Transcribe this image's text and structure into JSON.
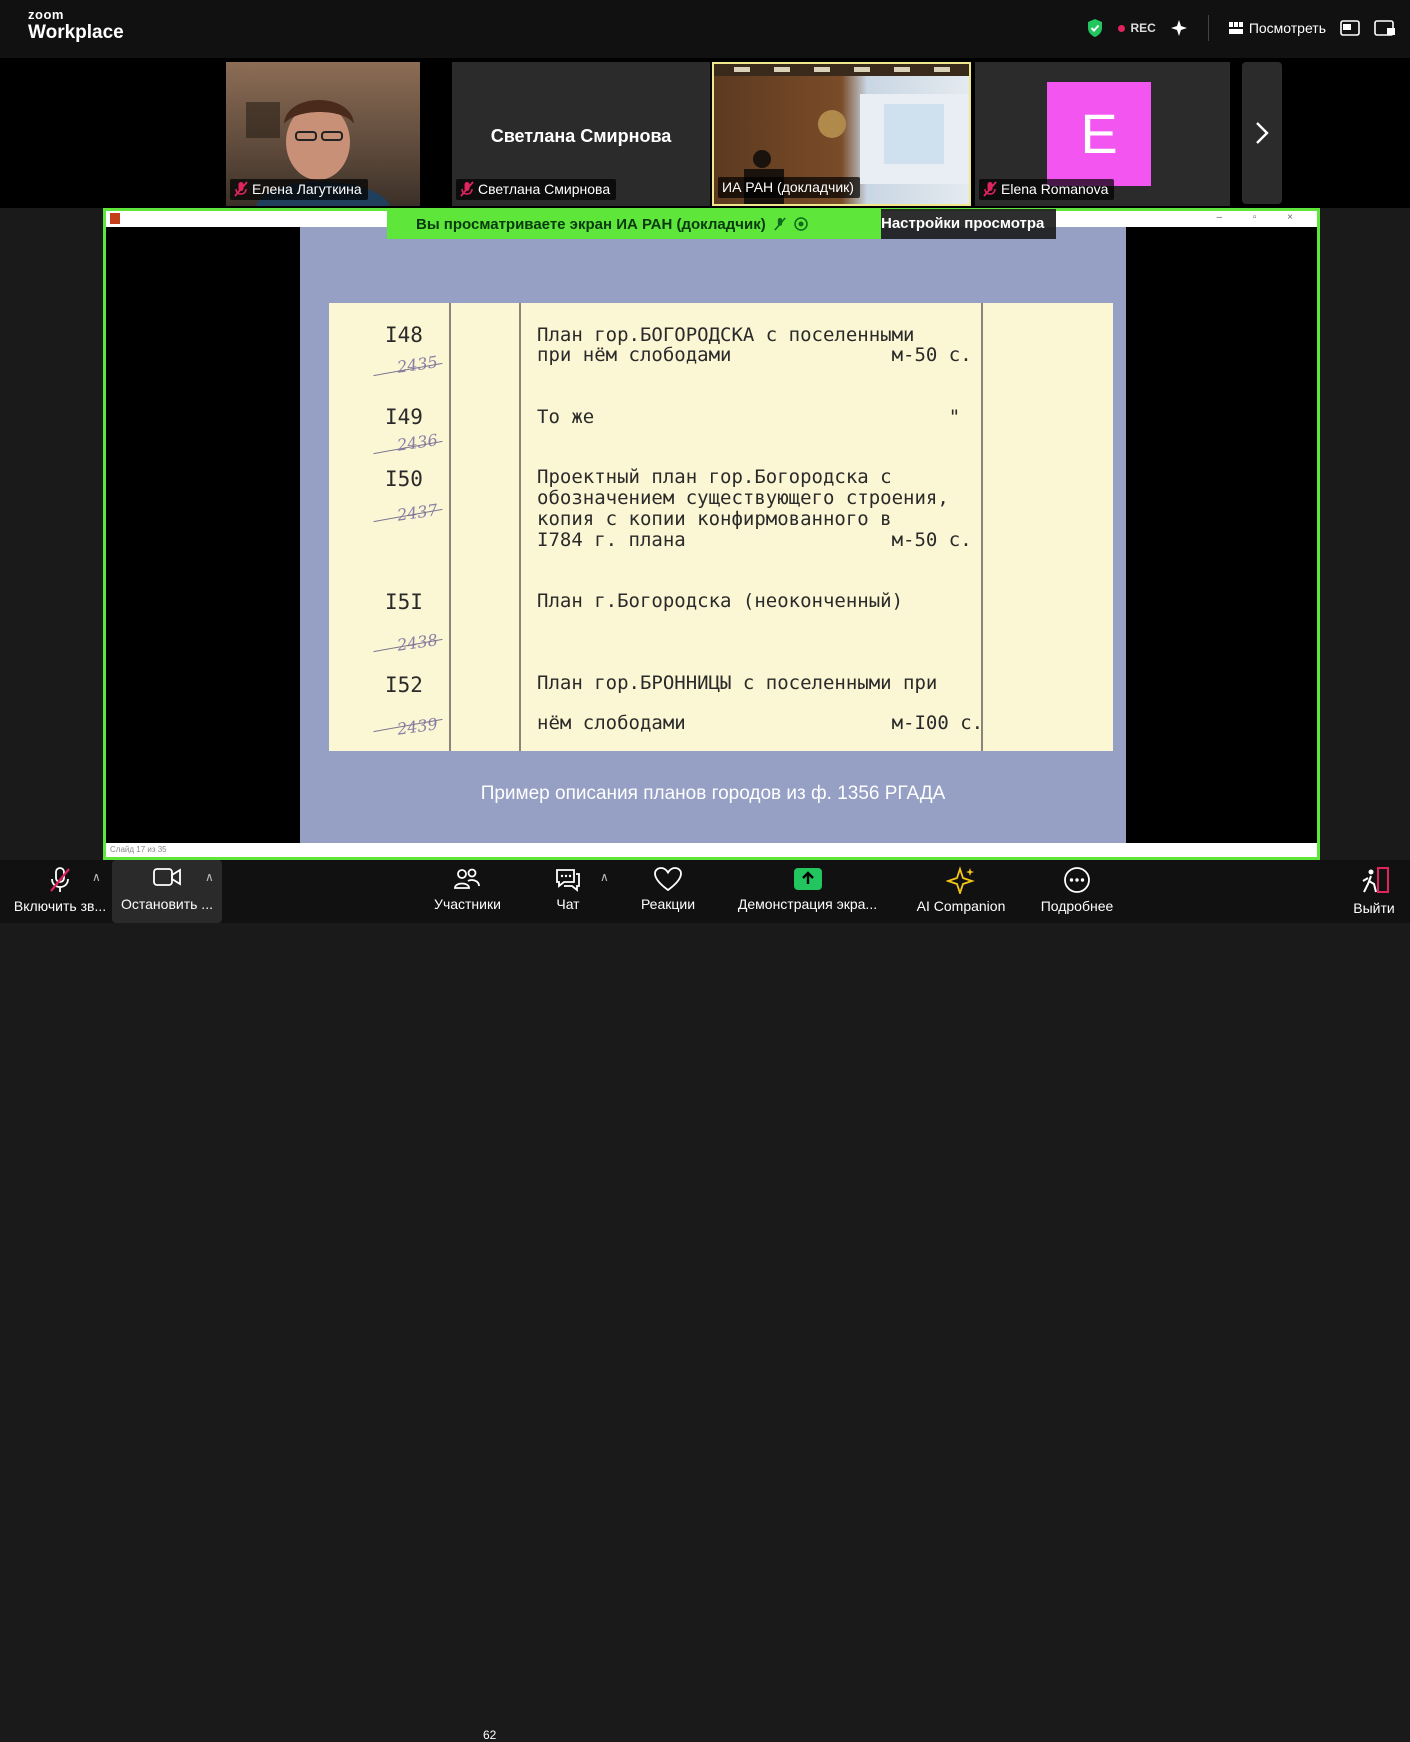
{
  "app": {
    "brand_small": "zoom",
    "brand_big": "Workplace"
  },
  "header": {
    "rec_label": "REC",
    "view_label": "Посмотреть"
  },
  "participants_strip": [
    {
      "name": "Елена Лагуткина"
    },
    {
      "name": "Светлана Смирнова",
      "display_name": "Светлана Смирнова"
    },
    {
      "name": "ИА РАН (докладчик)"
    },
    {
      "name": "Elena Romanova",
      "avatar_letter": "E"
    }
  ],
  "banner": {
    "text": "Вы просматриваете экран  ИА РАН (докладчик)",
    "options_label": "Настройки просмотра"
  },
  "slide": {
    "entries": [
      {
        "num": "I48",
        "hand": "2435",
        "lines": [
          "План гор.БОГОРОДСКА с поселенными",
          "при нём слободами              м-50 с."
        ]
      },
      {
        "num": "I49",
        "hand": "2436",
        "lines": [
          "То же                               \""
        ]
      },
      {
        "num": "I50",
        "hand": "2437",
        "lines": [
          "Проектный план гор.Богородска с",
          "обозначением существующего строения,",
          "копия с копии конфирмованного в",
          "I784 г. плана                  м-50 с."
        ]
      },
      {
        "num": "I5I",
        "hand": "2438",
        "lines": [
          "План г.Богородска (неоконченный)"
        ]
      },
      {
        "num": "I52",
        "hand": "2439",
        "lines": [
          "План гор.БРОННИЦЫ с поселенными при",
          "",
          "нём слободами                  м-I00 с."
        ]
      }
    ],
    "caption": "Пример описания планов городов из ф. 1356 РГАДА",
    "status_bar": "Слайд 17 из 35"
  },
  "toolbar": {
    "audio_label": "Включить зв...",
    "video_label": "Остановить ...",
    "participants_label": "Участники",
    "participants_count": "62",
    "chat_label": "Чат",
    "reactions_label": "Реакции",
    "share_label": "Демонстрация экра...",
    "ai_label": "AI Companion",
    "more_label": "Подробнее",
    "leave_label": "Выйти"
  },
  "colors": {
    "accent_green": "#5ee63a",
    "rec_red": "#e0245e",
    "leave_red": "#e0245e",
    "avatar_pink": "#f255f0"
  }
}
